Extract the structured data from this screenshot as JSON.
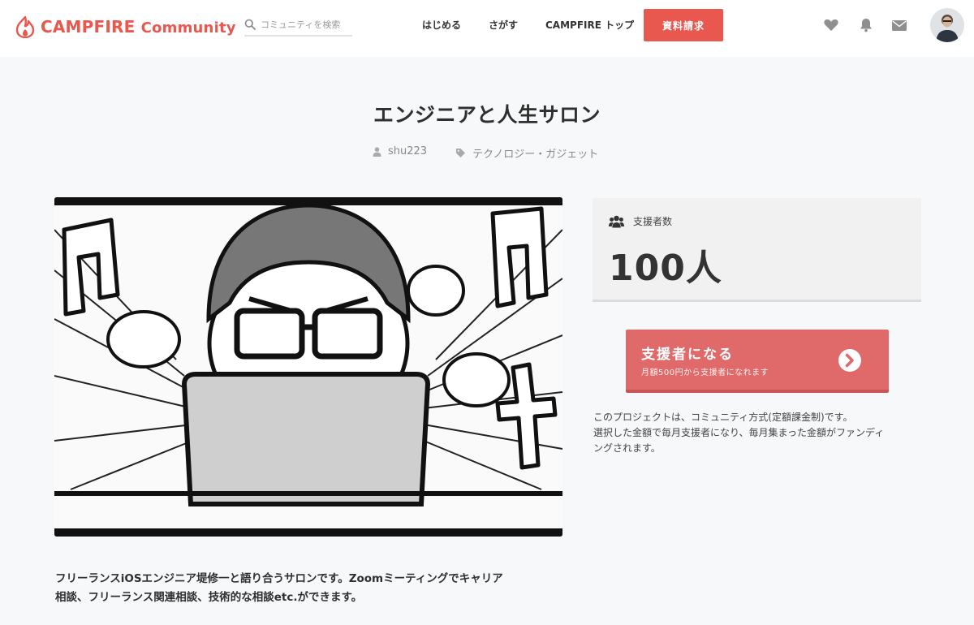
{
  "header": {
    "logo": {
      "brand": "CAMPFIRE",
      "suffix": "Community"
    },
    "search": {
      "placeholder": "コミュニティを検索"
    },
    "nav": [
      "はじめる",
      "さがす",
      "CAMPFIRE トップ"
    ],
    "cta": "資料請求",
    "icons": [
      "heart-icon",
      "bell-icon",
      "mail-icon"
    ]
  },
  "project": {
    "title": "エンジニアと人生サロン",
    "owner": "shu223",
    "category": "テクノロジー・ガジェット",
    "description_lines": [
      "フリーランスiOSエンジニア堤修一と語り合うサロンです。Zoomミーティングでキャリア",
      "相談、フリーランス関連相談、技術的な相談etc.ができます。"
    ]
  },
  "supporters": {
    "label": "支援者数",
    "count": "100人"
  },
  "support_button": {
    "title": "支援者になる",
    "subtitle": "月額500円から支援者になれます"
  },
  "note_lines": [
    "このプロジェクトは、コミュニティ方式(定額課金制)です。",
    "選択した金額で毎月支援者になり、毎月集まった金額がファンディ",
    "ングされます。"
  ],
  "colors": {
    "brand": "#e8584e",
    "support_button": "#e06a6a",
    "background": "#f7f8fa"
  }
}
